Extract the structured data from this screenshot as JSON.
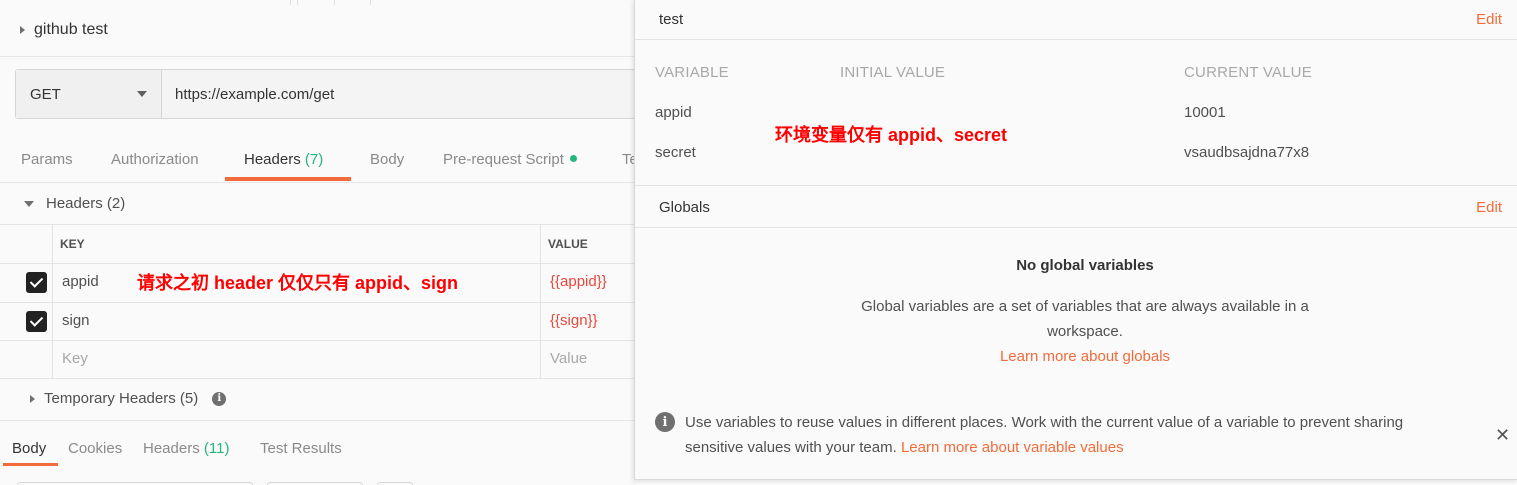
{
  "request": {
    "title": "github test",
    "method": "GET",
    "url": "https://example.com/get"
  },
  "request_tabs": {
    "params": "Params",
    "authorization": "Authorization",
    "headers_label": "Headers",
    "headers_count": "(7)",
    "body": "Body",
    "prerequest": "Pre-request Script",
    "tests": "Te"
  },
  "headers_section": {
    "label": "Headers (2)",
    "col_key": "KEY",
    "col_value": "VALUE",
    "rows": [
      {
        "key": "appid",
        "value": "{{appid}}",
        "checked": true
      },
      {
        "key": "sign",
        "value": "{{sign}}",
        "checked": true
      }
    ],
    "placeholder_key": "Key",
    "placeholder_value": "Value"
  },
  "temporary_headers": "Temporary Headers (5)",
  "response_tabs": {
    "body": "Body",
    "cookies": "Cookies",
    "headers_label": "Headers",
    "headers_count": "(11)",
    "test_results": "Test Results"
  },
  "annotations": {
    "left": "请求之初 header 仅仅只有 appid、sign",
    "right": "环境变量仅有 appid、secret"
  },
  "environment": {
    "name": "test",
    "edit": "Edit",
    "columns": {
      "variable": "VARIABLE",
      "initial": "INITIAL VALUE",
      "current": "CURRENT VALUE"
    },
    "variables": [
      {
        "name": "appid",
        "initial": "",
        "current": "10001"
      },
      {
        "name": "secret",
        "initial": "",
        "current": "vsaudbsajdna77x8"
      }
    ]
  },
  "globals": {
    "title": "Globals",
    "edit": "Edit",
    "empty_title": "No global variables",
    "empty_desc": "Global variables are a set of variables that are always available in a workspace.",
    "learn_more": "Learn more about globals"
  },
  "info_banner": {
    "text": "Use variables to reuse values in different places. Work with the current value of a variable to prevent sharing sensitive values with your team.",
    "link": "Learn more about variable values",
    "close": "✕"
  },
  "colors": {
    "accent": "#f26b3a",
    "success": "#26b47f",
    "variable": "#e5483c",
    "annotation": "#ff0000"
  }
}
